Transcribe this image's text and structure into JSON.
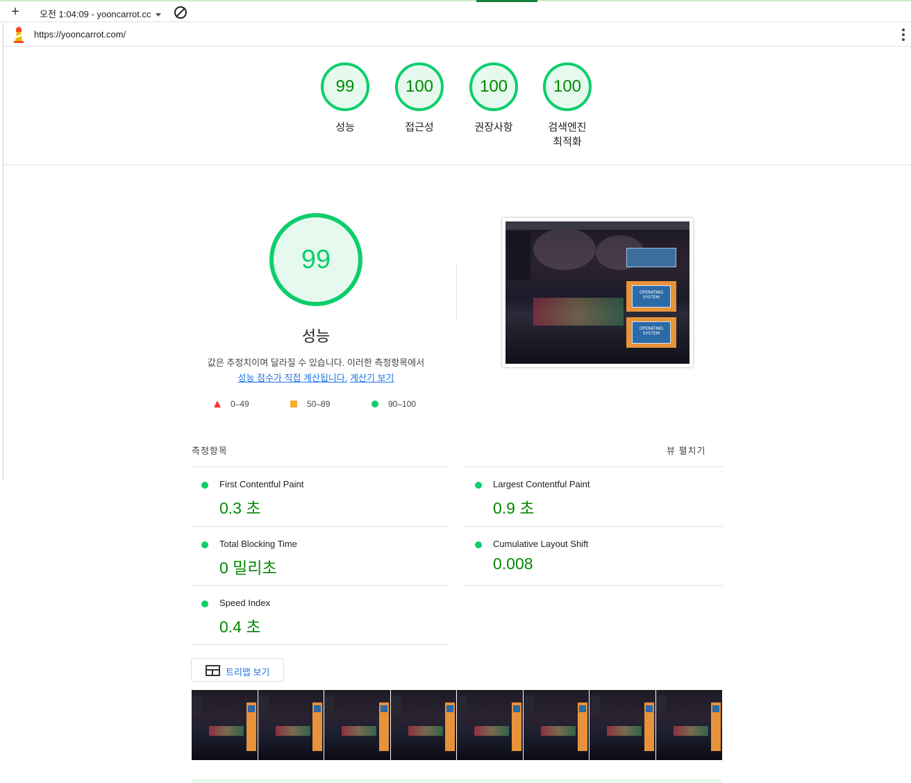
{
  "toolbar": {
    "add_label": "+",
    "run_label": "오전 1:04:09 - yooncarrot.cc"
  },
  "urlbar": {
    "url": "https://yooncarrot.com/"
  },
  "summary": {
    "gauges": [
      {
        "score": "99",
        "label": "성능"
      },
      {
        "score": "100",
        "label": "접근성"
      },
      {
        "score": "100",
        "label": "권장사항"
      },
      {
        "score": "100",
        "label_line1": "검색엔진",
        "label_line2": "최적화"
      }
    ]
  },
  "performance": {
    "score": "99",
    "title": "성능",
    "description": "값은 추정치이며 달라질 수 있습니다. 이러한 측정항목에서",
    "link1": "성능 점수가 직접 계산됩니다.",
    "link2": "계산기 보기",
    "legend": {
      "fail": "0–49",
      "average": "50–89",
      "pass": "90–100"
    },
    "screenshot_text": "OPERATING SYSTEM"
  },
  "metrics": {
    "title": "측정항목",
    "expand_label": "뷰 펼치기",
    "items": [
      {
        "name": "First Contentful Paint",
        "value": "0.3 초"
      },
      {
        "name": "Largest Contentful Paint",
        "value": "0.9 초"
      },
      {
        "name": "Total Blocking Time",
        "value": "0 밀리초"
      },
      {
        "name": "Cumulative Layout Shift",
        "value": "0.008"
      },
      {
        "name": "Speed Index",
        "value": "0.4 초"
      }
    ]
  },
  "treemap": {
    "label": "트리맵 보기"
  },
  "colors": {
    "pass": "#0cce6b",
    "pass_text": "#008800",
    "average": "#ffaa33",
    "fail": "#ff3333",
    "link": "#1a73e8"
  }
}
